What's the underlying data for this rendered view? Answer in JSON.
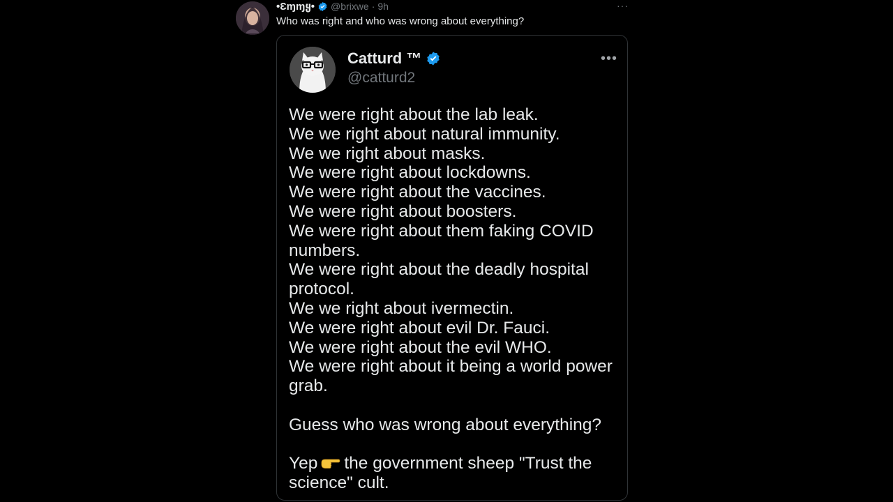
{
  "outer_tweet": {
    "display_name": "•Ɛɱɱყ•",
    "handle": "@brixwe",
    "separator": "·",
    "time": "9h",
    "more_label": "···",
    "text": "Who was right and who was wrong about everything?"
  },
  "quoted_tweet": {
    "display_name": "Catturd ™",
    "handle": "@catturd2",
    "more_label": "•••",
    "lines": [
      "We were right about the lab leak.",
      "We we right about natural immunity.",
      "We we right about masks.",
      "We were right about lockdowns.",
      "We were right about the vaccines.",
      "We were right about boosters.",
      "We were right about them faking COVID numbers.",
      "We were right about the deadly hospital protocol.",
      "We we right about ivermectin.",
      "We were right about evil Dr. Fauci.",
      "We were right about the evil WHO.",
      "We were right about it being a world power grab."
    ],
    "closing_question": "Guess who was wrong about everything?",
    "final_prefix": "Yep",
    "final_suffix": "the government sheep \"Trust the science\" cult."
  },
  "icons": {
    "verified": "verified-badge-icon",
    "pointing_hand": "pointing-right-hand-emoji"
  },
  "colors": {
    "background": "#000000",
    "text_primary": "#e7e9ea",
    "text_secondary": "#71767b",
    "verified_blue": "#1d9bf0",
    "card_border": "#2f3336"
  }
}
